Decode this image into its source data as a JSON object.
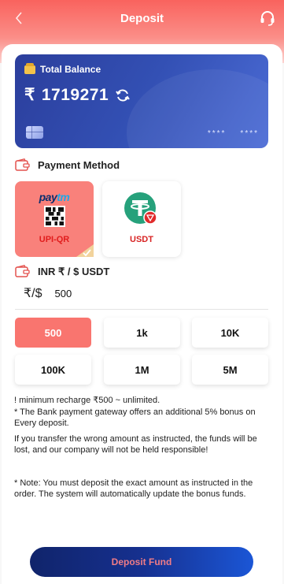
{
  "header": {
    "title": "Deposit",
    "back_icon": "chevron-left-icon",
    "support_icon": "headset-icon"
  },
  "balance_card": {
    "label": "Total Balance",
    "currency_symbol": "₹",
    "amount": "1719271",
    "card_mask_1": "****",
    "card_mask_2": "****"
  },
  "payment_method": {
    "heading": "Payment Method",
    "options": [
      {
        "brand_a": "pay",
        "brand_b": "tm",
        "label": "UPI-QR",
        "selected": true
      },
      {
        "label": "USDT",
        "selected": false
      }
    ]
  },
  "amount_section": {
    "heading": "INR ₹ / $ USDT",
    "symbol": "₹/$",
    "value": "500"
  },
  "presets": [
    "500",
    "1k",
    "10K",
    "100K",
    "1M",
    "5M"
  ],
  "notes": {
    "line1": "! minimum recharge ₹500 ~ unlimited.",
    "line2": "* The Bank payment gateway offers an additional 5% bonus on Every deposit.",
    "line3": "If you transfer the wrong amount as instructed, the funds will be lost, and our company will not be held responsible!",
    "line4": "* Note: You must deposit the exact amount as instructed in the order. The system will automatically update the bonus funds."
  },
  "submit": {
    "label": "Deposit Fund"
  },
  "colors": {
    "accent": "#f9756f",
    "card": "#3350b4",
    "button": "#16308f"
  }
}
